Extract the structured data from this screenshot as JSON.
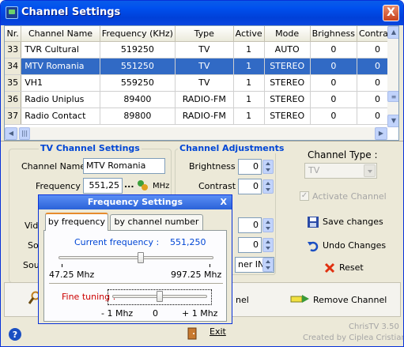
{
  "window": {
    "title": "Channel Settings",
    "close": "X"
  },
  "table": {
    "headers": [
      "Nr.",
      "Channel Name",
      "Frequency (KHz)",
      "Type",
      "Active",
      "Mode",
      "Brighness",
      "Contrast"
    ],
    "rows": [
      {
        "nr": "33",
        "name": "TVR Cultural",
        "freq": "519250",
        "type": "TV",
        "active": "1",
        "mode": "AUTO",
        "bright": "0",
        "contrast": "0"
      },
      {
        "nr": "34",
        "name": "MTV Romania",
        "freq": "551250",
        "type": "TV",
        "active": "1",
        "mode": "STEREO",
        "bright": "0",
        "contrast": "0"
      },
      {
        "nr": "35",
        "name": "VH1",
        "freq": "559250",
        "type": "TV",
        "active": "1",
        "mode": "STEREO",
        "bright": "0",
        "contrast": "0"
      },
      {
        "nr": "36",
        "name": "Radio Uniplus",
        "freq": "89400",
        "type": "RADIO-FM",
        "active": "1",
        "mode": "STEREO",
        "bright": "0",
        "contrast": "0"
      },
      {
        "nr": "37",
        "name": "Radio Contact",
        "freq": "89800",
        "type": "RADIO-FM",
        "active": "1",
        "mode": "STEREO",
        "bright": "0",
        "contrast": "0"
      }
    ]
  },
  "tv_settings": {
    "title": "TV Channel Settings",
    "name_label": "Channel Name :",
    "name_value": "MTV Romania",
    "freq_label": "Frequency :",
    "freq_value": "551,25",
    "freq_dots": "...",
    "freq_unit": "MHz",
    "label_vide": "Vide",
    "label_so": "So",
    "label_sou": "Sou"
  },
  "adjust": {
    "title": "Channel Adjustments",
    "brightness_label": "Brightness :",
    "brightness_value": "0",
    "contrast_label": "Contrast :",
    "contrast_value": "0",
    "extra_value_1": "0",
    "extra_value_2": "0",
    "tuner_value": "ner IN"
  },
  "right_panel": {
    "type_label": "Channel Type :",
    "type_value": "TV",
    "activate_label": "Activate Channel",
    "save_label": "Save changes",
    "undo_label": "Undo Changes",
    "reset_label": "Reset"
  },
  "bottom": {
    "partial_label": "nel",
    "remove_label": "Remove Channel",
    "exit_label": "Exit",
    "version": "ChrisTV 3.50",
    "credit": "Created by Ciplea Cristian"
  },
  "freq_dialog": {
    "title": "Frequency Settings",
    "close": "X",
    "tab1": "by frequency",
    "tab2": "by channel number",
    "current_label": "Current frequency :",
    "current_value": "551,250",
    "min_label": "47.25 Mhz",
    "max_label": "997.25 Mhz",
    "slider_fraction": 0.53,
    "fine_label": "Fine tuning :",
    "fine_min": "- 1 Mhz",
    "fine_mid": "0",
    "fine_max": "+ 1 Mhz",
    "fine_fraction": 0.5
  },
  "colors": {
    "title_bar": "#0a5ce9",
    "selection": "#316ac5",
    "group_title": "#0046d5",
    "freq_text": "#0046d5",
    "fine_tuning": "#cc0000"
  }
}
